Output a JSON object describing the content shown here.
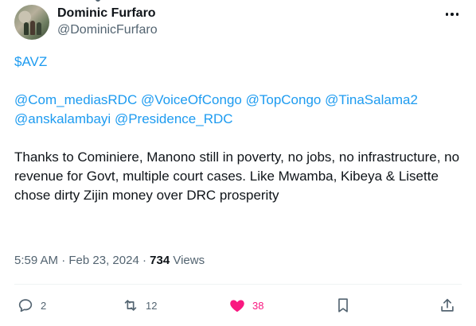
{
  "author": {
    "display_name": "Dominic Furfaro",
    "handle": "@DominicFurfaro"
  },
  "tweet": {
    "cashtag": "$AVZ",
    "mentions_line1": [
      "@Com_mediasRDC",
      "@VoiceOfCongo",
      "@TopCongo",
      "@TinaSalama2"
    ],
    "mentions_line2": [
      "@anskalambayi",
      "@Presidence_RDC"
    ],
    "text": "Thanks to Cominiere, Manono still in poverty, no jobs, no infrastructure, no revenue for Govt, multiple court cases. Like Mwamba, Kibeya & Lisette chose dirty Zijin money over DRC prosperity"
  },
  "meta": {
    "time": "5:59 AM",
    "separator": "·",
    "date": "Feb 23, 2024",
    "views_count": "734",
    "views_label": "Views"
  },
  "actions": {
    "reply_count": "2",
    "repost_count": "12",
    "like_count": "38"
  },
  "colors": {
    "link": "#1d9bf0",
    "like": "#f91880",
    "secondary_text": "#536471",
    "primary_text": "#0f1419"
  },
  "icons": {
    "more": "more-horizontal-icon",
    "reply": "reply-icon",
    "repost": "repost-icon",
    "like": "heart-filled-icon",
    "bookmark": "bookmark-icon",
    "share": "share-icon"
  }
}
